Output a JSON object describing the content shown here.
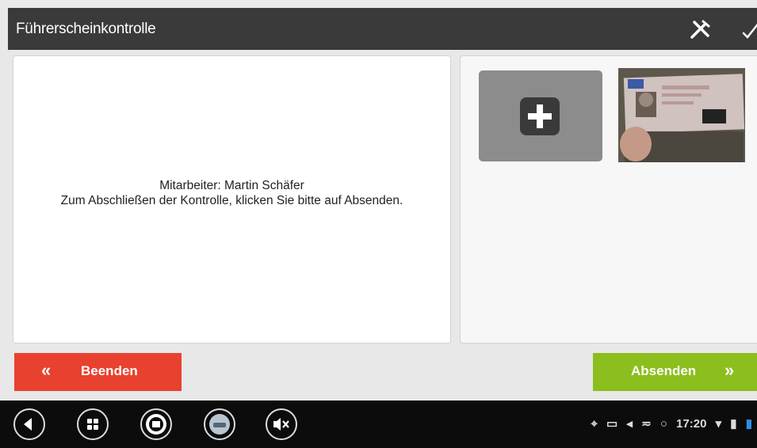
{
  "app": {
    "title": "Führerscheinkontrolle"
  },
  "message": {
    "line1": "Mitarbeiter: Martin Schäfer",
    "line2": "Zum Abschließen der Kontrolle, klicken Sie bitte auf Absenden."
  },
  "buttons": {
    "end_label": "Beenden",
    "end_arrows": "«",
    "send_label": "Absenden",
    "send_arrows": "»"
  },
  "status_bar": {
    "time": "17:20"
  },
  "icons": {
    "header": [
      "tools-icon",
      "check-icon"
    ],
    "nav": [
      "back-icon",
      "apps-icon",
      "speed-limit-icon",
      "navigation-car-icon",
      "mute-icon"
    ],
    "status": [
      "location-icon",
      "image-icon",
      "send-icon",
      "usb-icon",
      "sync-icon",
      "wifi-icon",
      "signal-icon",
      "battery-icon"
    ]
  },
  "colors": {
    "header": "#3a3a3a",
    "end_button": "#e8412f",
    "send_button": "#8cbe1d",
    "nav_bar": "#0c0c0c"
  }
}
